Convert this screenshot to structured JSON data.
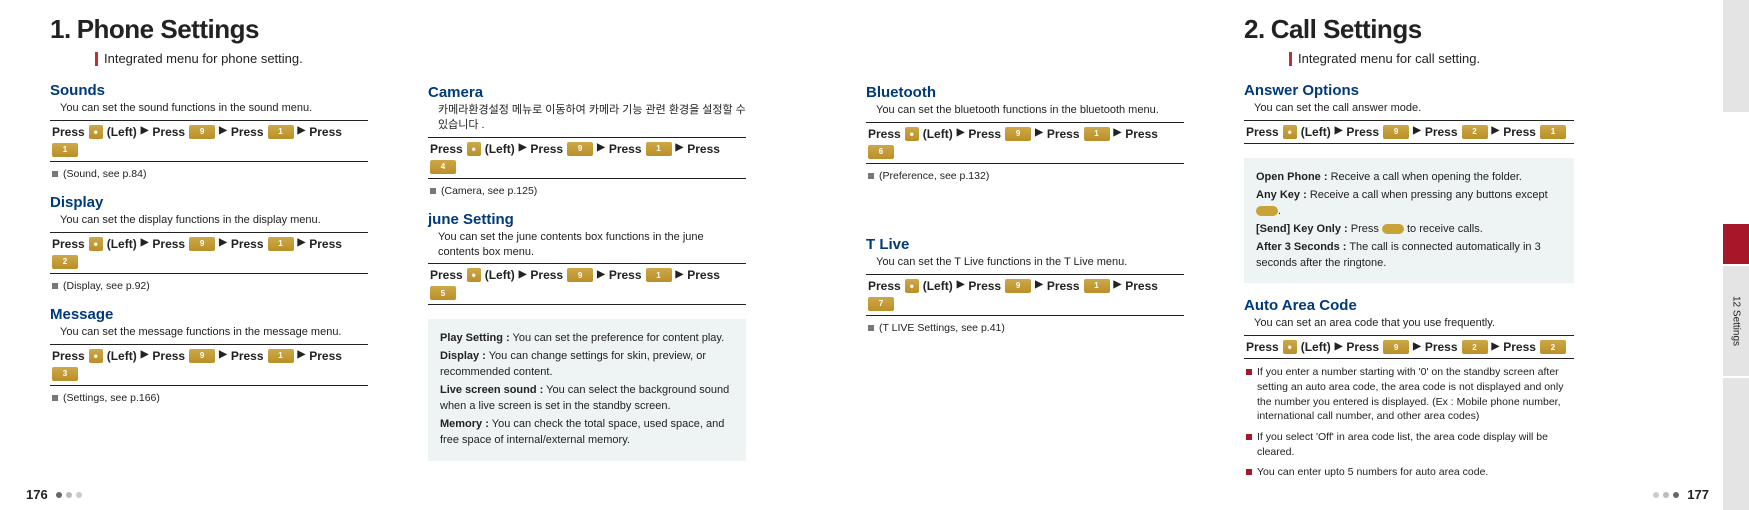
{
  "leftHeader": {
    "num": "1.",
    "title": "Phone Settings",
    "subtitle": "Integrated menu for phone setting."
  },
  "rightHeader": {
    "num": "2.",
    "title": "Call Settings",
    "subtitle": "Integrated menu for call setting."
  },
  "sideTab": "12  Settings",
  "pressWord": "Press",
  "leftLabel": "(Left)",
  "arrow": "▶",
  "keys": {
    "dot": "•",
    "k9": "9",
    "k1": "1",
    "k2": "2",
    "k3": "3",
    "k4": "4",
    "k5": "5",
    "k6": "6",
    "k7": "7"
  },
  "col1": {
    "sounds": {
      "title": "Sounds",
      "desc": "You can set the sound functions in the sound menu.",
      "seq": [
        "dot",
        "k9",
        "k1",
        "k1"
      ],
      "note": "(Sound, see p.84)"
    },
    "display": {
      "title": "Display",
      "desc": "You can set the display functions in the display menu.",
      "seq": [
        "dot",
        "k9",
        "k1",
        "k2"
      ],
      "note": "(Display, see p.92)"
    },
    "message": {
      "title": "Message",
      "desc": "You can set the message functions in the message menu.",
      "seq": [
        "dot",
        "k9",
        "k1",
        "k3"
      ],
      "note": "(Settings, see p.166)"
    }
  },
  "col2": {
    "camera": {
      "title": "Camera",
      "desc": "카메라환경설정 메뉴로 이동하여 카메라 기능 관련 환경을 설정할 수 있습니다 .",
      "seq": [
        "dot",
        "k9",
        "k1",
        "k4"
      ],
      "note": "(Camera, see p.125)"
    },
    "june": {
      "title": "june Setting",
      "desc": "You can set the june contents box functions in the june contents box menu.",
      "seq": [
        "dot",
        "k9",
        "k1",
        "k5"
      ]
    },
    "infobox": {
      "r1_lbl": "Play Setting :",
      "r1_txt": "You can set the preference for content play.",
      "r2_lbl": "Display :",
      "r2_txt": "You can change settings for skin, preview, or recommended content.",
      "r3_lbl": "Live screen sound :",
      "r3_txt": "You can select the background sound when a live screen is set in the standby screen.",
      "r4_lbl": "Memory :",
      "r4_txt": "You can check the total space, used space, and free space of internal/external memory."
    }
  },
  "col3": {
    "bluetooth": {
      "title": "Bluetooth",
      "desc": "You can set the bluetooth functions in the bluetooth menu.",
      "seq": [
        "dot",
        "k9",
        "k1",
        "k6"
      ],
      "note": "(Preference, see p.132)"
    },
    "tlive": {
      "title": "T Live",
      "desc": "You can set the T Live functions in the T Live menu.",
      "seq": [
        "dot",
        "k9",
        "k1",
        "k7"
      ],
      "note": "(T LIVE Settings, see p.41)"
    }
  },
  "col4": {
    "answer": {
      "title": "Answer Options",
      "desc": "You can set the call answer mode.",
      "seq": [
        "dot",
        "k9",
        "k2",
        "k1"
      ]
    },
    "answerBox": {
      "r1_lbl": "Open Phone :",
      "r1_txt": "Receive a call when opening the folder.",
      "r2_lbl": "Any Key :",
      "r2_txt_a": "Receive a call when pressing any buttons except ",
      "r2_txt_b": ".",
      "r3_lbl": "[Send] Key Only :",
      "r3_txt_a": "Press ",
      "r3_txt_b": " to receive calls.",
      "r4_lbl": "After 3 Seconds :",
      "r4_txt": "The call is connected automatically in 3 seconds after the ringtone."
    },
    "area": {
      "title": "Auto Area Code",
      "desc": "You can set an area code that you use frequently.",
      "seq": [
        "dot",
        "k9",
        "k2",
        "k2"
      ],
      "n1": "If you enter a number starting with '0' on the standby screen after setting an auto area code, the area code is not displayed and only the number you entered is displayed. (Ex : Mobile phone number, international call number, and other area codes)",
      "n2": "If you select 'Off' in  area code list, the area code display will be cleared.",
      "n3": "You can enter upto 5 numbers for auto area code."
    }
  },
  "pageLeft": "176",
  "pageRight": "177"
}
